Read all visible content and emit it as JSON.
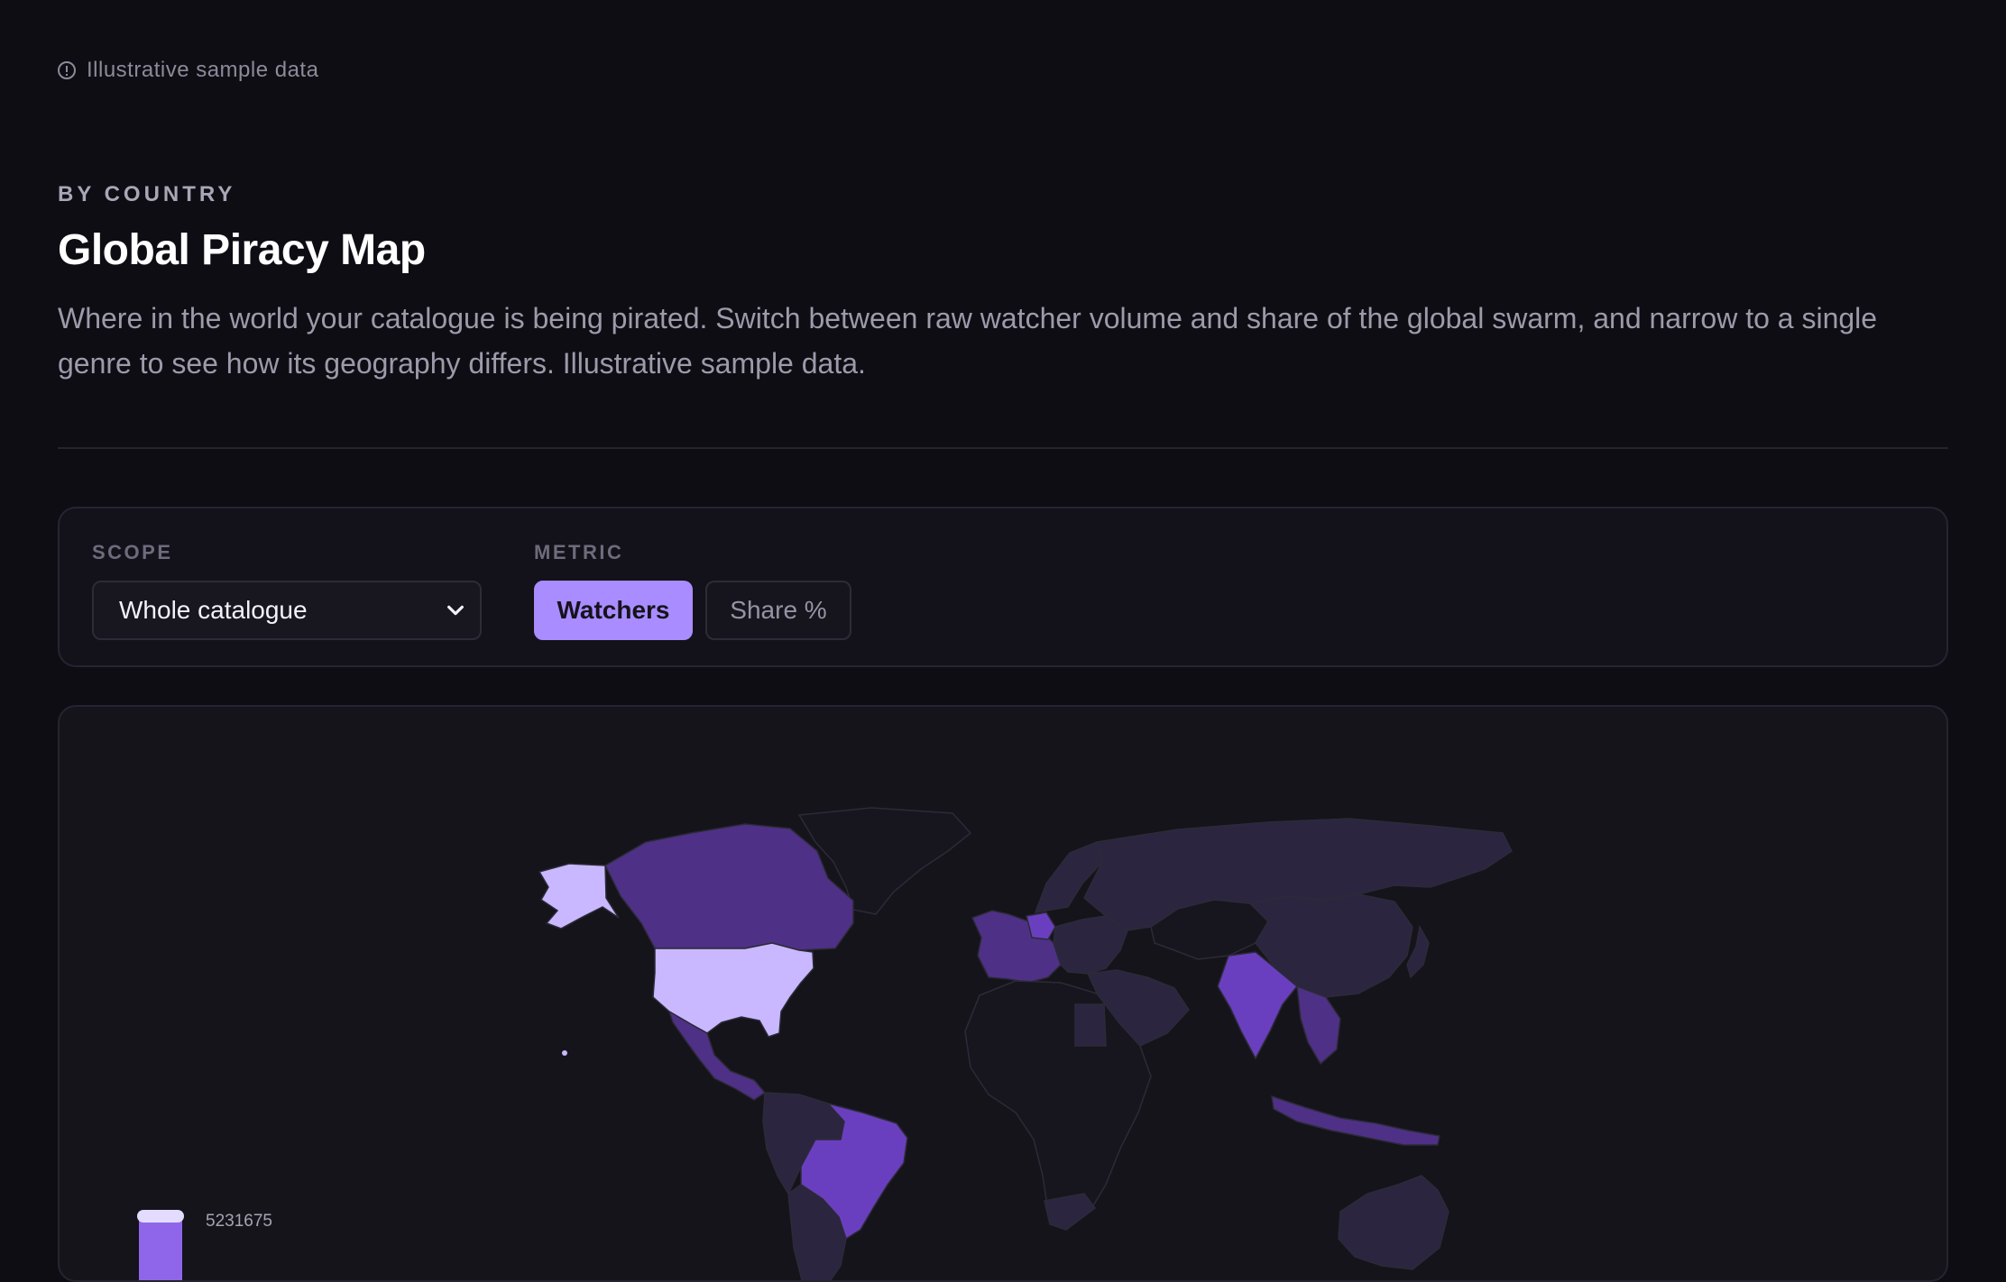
{
  "notice": {
    "text": "Illustrative sample data",
    "icon": "info-icon"
  },
  "header": {
    "eyebrow": "BY COUNTRY",
    "title": "Global Piracy Map",
    "description": "Where in the world your catalogue is being pirated. Switch between raw watcher volume and share of the global swarm, and narrow to a single genre to see how its geography differs. Illustrative sample data."
  },
  "controls": {
    "scope_label": "SCOPE",
    "scope_value": "Whole catalogue",
    "metric_label": "METRIC",
    "metric_options": [
      "Watchers",
      "Share %"
    ],
    "metric_selected": "Watchers"
  },
  "legend": {
    "max_value": "5231675"
  },
  "colors": {
    "background": "#0e0d14",
    "accent": "#a98cff",
    "map_highest": "#c9b8ff",
    "map_high": "#6a3fbf",
    "map_mid": "#4e3186",
    "map_low": "#2b2540",
    "map_none": "#17161e"
  }
}
